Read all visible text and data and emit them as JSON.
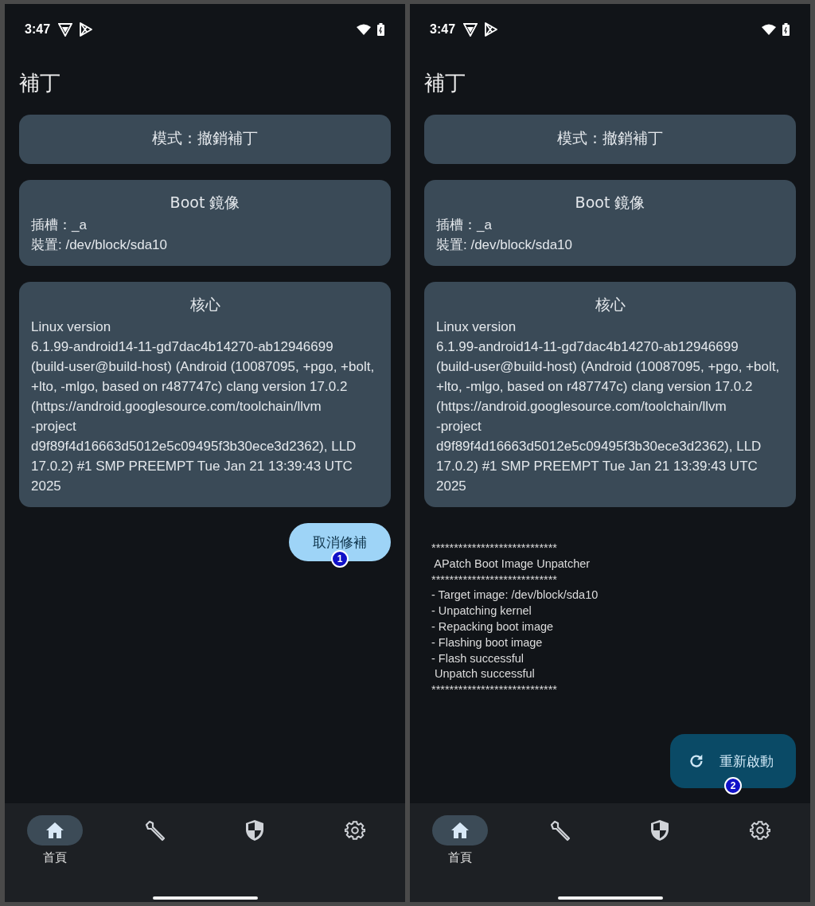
{
  "screens": [
    {
      "status_bar": {
        "time": "3:47"
      },
      "title": "補丁",
      "cards": [
        {
          "kind": "mode",
          "title": "模式：撤銷補丁"
        },
        {
          "kind": "info",
          "title": "Boot 鏡像",
          "lines": [
            "插槽：_a",
            "裝置: /dev/block/sda10"
          ]
        },
        {
          "kind": "info",
          "title": "核心",
          "lines": [
            "Linux version",
            "6.1.99-android14-11-gd7dac4b14270-ab12946699",
            "(build-user@build-host) (Android (10087095, +pgo, +bolt,",
            "+lto, -mlgo, based on r487747c) clang version 17.0.2",
            "(https://android.googlesource.com/toolchain/llvm",
            "-project",
            "d9f89f4d16663d5012e5c09495f3b30ece3d2362), LLD",
            "17.0.2) #1 SMP PREEMPT Tue Jan 21 13:39:43 UTC",
            "2025"
          ]
        }
      ],
      "action": {
        "kind": "pill",
        "label": "取消修補",
        "badge": "1"
      },
      "nav": [
        {
          "kind": "home",
          "label": "首頁",
          "selected": true
        },
        {
          "kind": "wrench",
          "selected": false
        },
        {
          "kind": "shield",
          "selected": false
        },
        {
          "kind": "gear",
          "selected": false
        }
      ]
    },
    {
      "status_bar": {
        "time": "3:47"
      },
      "title": "補丁",
      "cards": [
        {
          "kind": "mode",
          "title": "模式：撤銷補丁"
        },
        {
          "kind": "info",
          "title": "Boot 鏡像",
          "lines": [
            "插槽：_a",
            "裝置: /dev/block/sda10"
          ]
        },
        {
          "kind": "info",
          "title": "核心",
          "lines": [
            "Linux version",
            "6.1.99-android14-11-gd7dac4b14270-ab12946699",
            "(build-user@build-host) (Android (10087095, +pgo, +bolt,",
            "+lto, -mlgo, based on r487747c) clang version 17.0.2",
            "(https://android.googlesource.com/toolchain/llvm",
            "-project",
            "d9f89f4d16663d5012e5c09495f3b30ece3d2362), LLD",
            "17.0.2) #1 SMP PREEMPT Tue Jan 21 13:39:43 UTC",
            "2025"
          ]
        }
      ],
      "log": [
        "****************************",
        " APatch Boot Image Unpatcher",
        "****************************",
        "- Target image: /dev/block/sda10",
        "- Unpatching kernel",
        "- Repacking boot image",
        "- Flashing boot image",
        "- Flash successful",
        " Unpatch successful",
        "****************************"
      ],
      "action": {
        "kind": "fab",
        "label": "重新啟動",
        "badge": "2"
      },
      "nav": [
        {
          "kind": "home",
          "label": "首頁",
          "selected": true
        },
        {
          "kind": "wrench",
          "selected": false
        },
        {
          "kind": "shield",
          "selected": false
        },
        {
          "kind": "gear",
          "selected": false
        }
      ]
    }
  ]
}
